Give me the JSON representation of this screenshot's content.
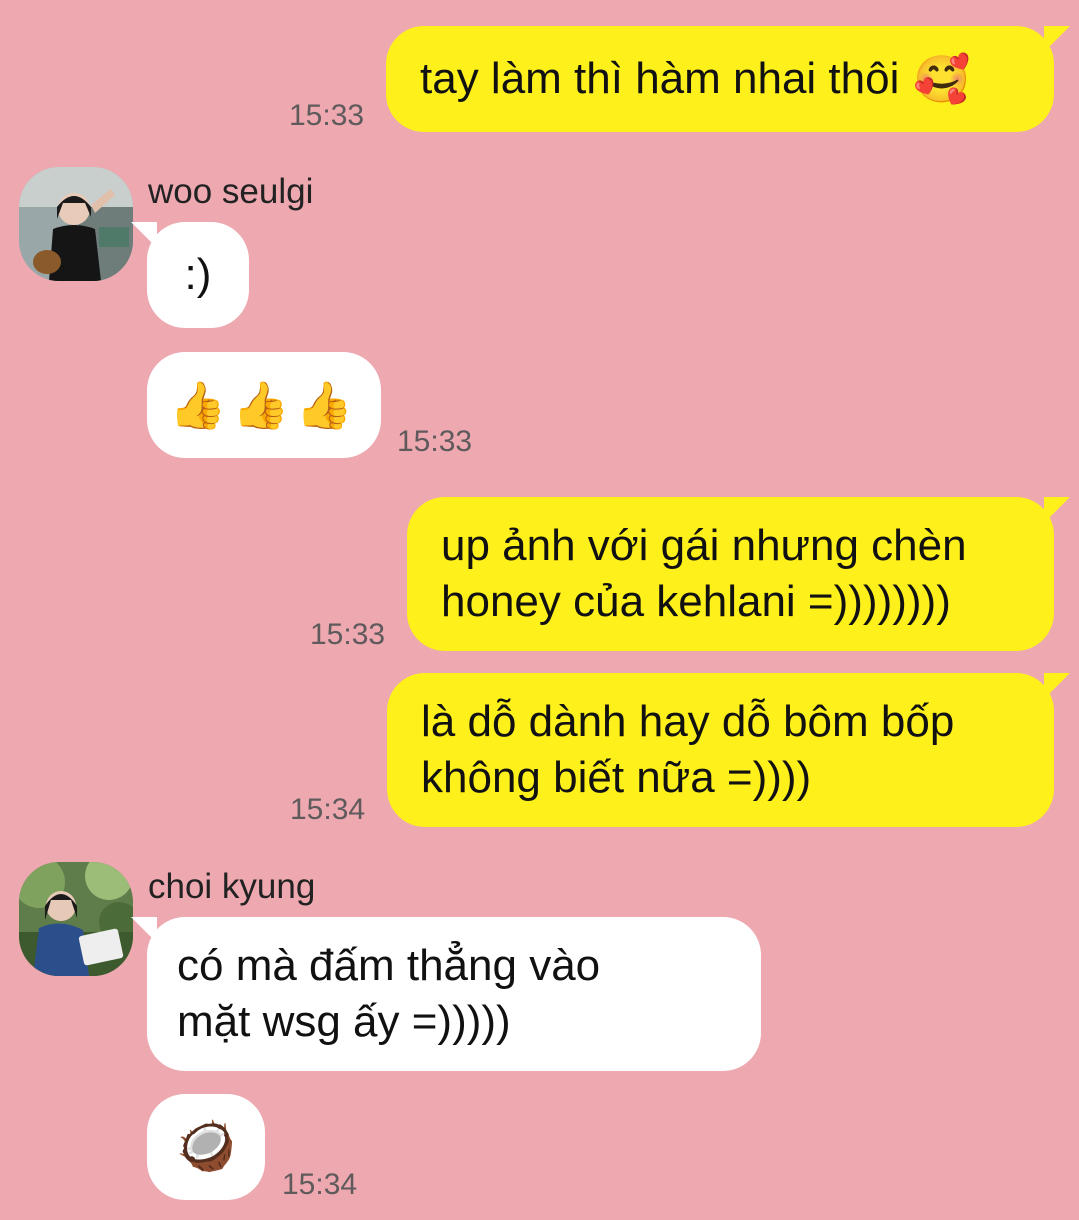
{
  "messages": [
    {
      "side": "me",
      "text": "tay làm thì hàm nhai thôi",
      "emoji": "🥰",
      "time": "15:33"
    },
    {
      "side": "them",
      "sender": "woo seulgi",
      "text": ":)"
    },
    {
      "side": "them",
      "emoji_row": "👍👍👍",
      "time": "15:33"
    },
    {
      "side": "me",
      "lines": [
        "up ảnh với gái nhưng chèn",
        "honey của kehlani =))))))))"
      ],
      "time": "15:33"
    },
    {
      "side": "me",
      "lines": [
        "là dỗ dành hay dỗ bôm bốp",
        "không biết nữa =))))"
      ],
      "time": "15:34"
    },
    {
      "side": "them",
      "sender": "choi kyung",
      "lines": [
        "có mà đấm thẳng vào",
        "mặt wsg ấy =)))))"
      ]
    },
    {
      "side": "them",
      "emoji": "🥥",
      "time": "15:34"
    }
  ],
  "colors": {
    "background": "#eda8b0",
    "me_bubble": "#fef01b",
    "them_bubble": "#ffffff"
  },
  "avatars": [
    "avatar-woo-seulgi",
    "avatar-choi-kyung"
  ]
}
